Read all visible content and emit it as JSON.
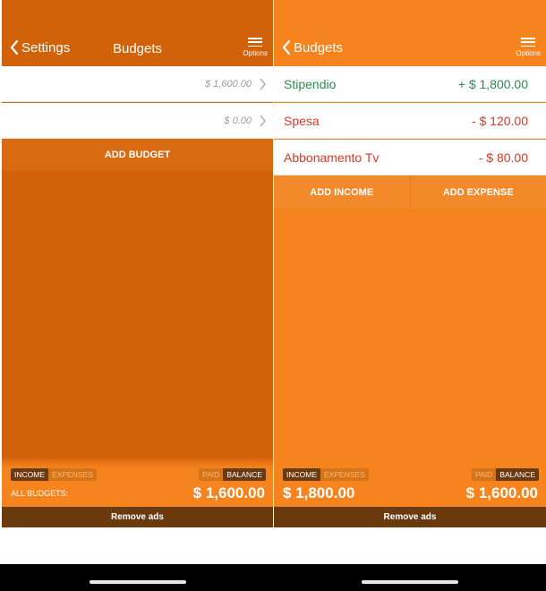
{
  "left": {
    "nav": {
      "back_label": "Settings",
      "title": "Budgets",
      "options_label": "Options"
    },
    "rows": [
      {
        "amount": "$ 1,600.00"
      },
      {
        "amount": "$ 0.00"
      }
    ],
    "add_budget_label": "ADD BUDGET",
    "footer": {
      "seg1": [
        "INCOME",
        "EXPENSES"
      ],
      "seg2": [
        "PAID",
        "BALANCE"
      ],
      "label": "ALL BUDGETS:",
      "amount": "$ 1,600.00"
    },
    "remove_ads_label": "Remove ads"
  },
  "right": {
    "nav": {
      "back_label": "Budgets",
      "options_label": "Options"
    },
    "transactions": [
      {
        "name": "Stipendio",
        "amount": "+ $ 1,800.00",
        "kind": "income"
      },
      {
        "name": "Spesa",
        "amount": "- $ 120.00",
        "kind": "expense"
      },
      {
        "name": "Abbonamento Tv",
        "amount": "- $ 80.00",
        "kind": "expense"
      }
    ],
    "add_income_label": "ADD INCOME",
    "add_expense_label": "ADD EXPENSE",
    "footer": {
      "seg1": [
        "INCOME",
        "EXPENSES"
      ],
      "seg2": [
        "PAID",
        "BALANCE"
      ],
      "left_amount": "$ 1,800.00",
      "right_amount": "$ 1,600.00"
    },
    "remove_ads_label": "Remove ads"
  },
  "colors": {
    "orange": "#f5831e",
    "dark_orange": "#d2620a",
    "brown": "#6b3a0c",
    "income_green": "#2f8a4f",
    "expense_red": "#d43a2a"
  },
  "icons": {
    "back": "chevron-left-icon",
    "options": "hamburger-menu-icon",
    "row": "chevron-right-icon"
  }
}
